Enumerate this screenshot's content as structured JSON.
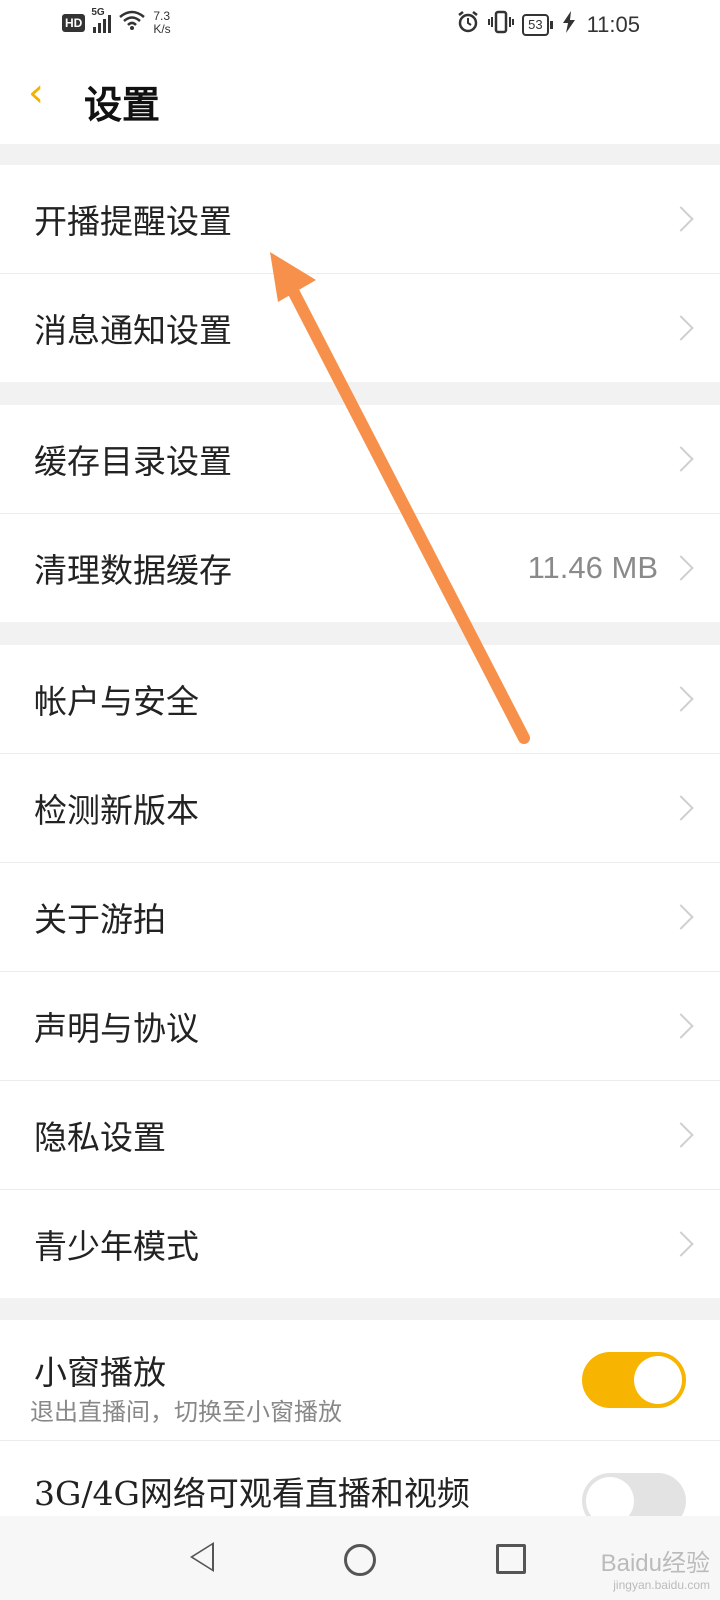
{
  "status_bar": {
    "hd": "HD",
    "signal_label": "5G",
    "net_speed_value": "7.3",
    "net_speed_unit": "K/s",
    "battery": "53",
    "time": "11:05"
  },
  "header": {
    "title": "设置"
  },
  "groups": {
    "g1": [
      {
        "label": "开播提醒设置"
      },
      {
        "label": "消息通知设置"
      }
    ],
    "g2": [
      {
        "label": "缓存目录设置"
      },
      {
        "label": "清理数据缓存",
        "value": "11.46 MB"
      }
    ],
    "g3": [
      {
        "label": "帐户与安全"
      },
      {
        "label": "检测新版本"
      },
      {
        "label": "关于游拍"
      },
      {
        "label": "声明与协议"
      },
      {
        "label": "隐私设置"
      },
      {
        "label": "青少年模式"
      }
    ],
    "g4": [
      {
        "label": "小窗播放",
        "sub": "退出直播间，切换至小窗播放",
        "on": true
      },
      {
        "label": "3G/4G网络可观看直播和视频",
        "on": false
      }
    ]
  },
  "colors": {
    "accent": "#f7b400",
    "annotation_arrow": "#f7904a"
  },
  "watermark": {
    "brand": "Baidu经验",
    "url": "jingyan.baidu.com"
  }
}
